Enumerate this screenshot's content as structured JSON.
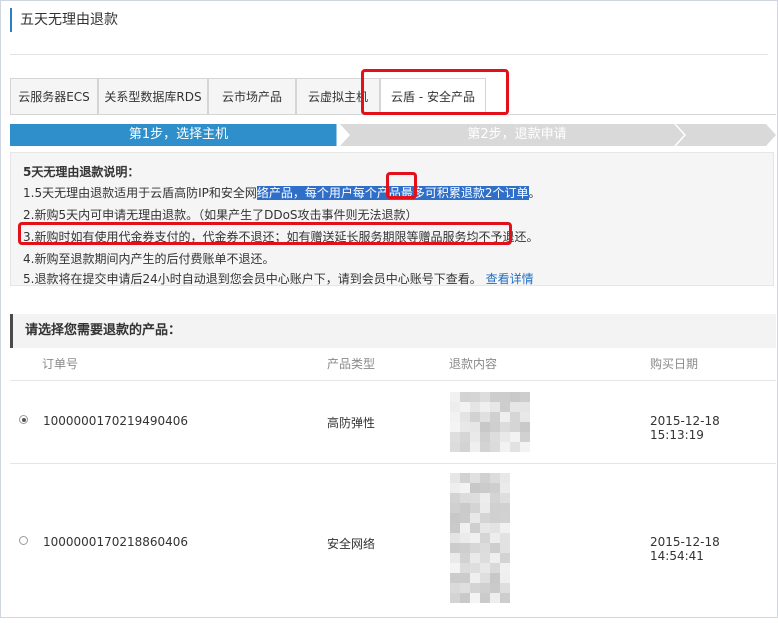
{
  "page": {
    "title": "五天无理由退款"
  },
  "tabs": [
    {
      "label": "云服务器ECS"
    },
    {
      "label": "关系型数据库RDS"
    },
    {
      "label": "云市场产品"
    },
    {
      "label": "云虚拟主机"
    },
    {
      "label": "云盾 - 安全产品",
      "active": true
    }
  ],
  "steps": [
    {
      "label": "第1步，选择主机",
      "active": true
    },
    {
      "label": "第2步，退款申请",
      "active": false
    }
  ],
  "notes": {
    "heading": "5天无理由退款说明：",
    "line1_plain": "1.5天无理由退款适用于云盾高防IP和安全网",
    "line1_highlight_a": "络产品，每个用户每个产品最多可",
    "line1_boxed": "积累",
    "line1_highlight_b": "退款2个订单",
    "line1_end": "。",
    "line2": "2.新购5天内可申请无理由退款。（如果产生了DDoS攻击事件则无法退款）",
    "line3": "3.新购时如有使用代金券支付的，代金券不退还；如有赠送延长服务期限等赠品服务均不予退还。",
    "line4": "4.新购至退款期间内产生的后付费账单不退还。",
    "line5": "5.退款将在提交申请后24小时自动退到您会员中心账户下，请到会员中心账号下查看。",
    "line5_link": "查看详情"
  },
  "section": {
    "title": "请选择您需要退款的产品："
  },
  "table": {
    "headers": [
      "订单号",
      "产品类型",
      "退款内容",
      "购买日期"
    ],
    "rows": [
      {
        "selected": true,
        "order": "1000000170219490406",
        "type": "高防弹性",
        "date": "2015-12-18 15:13:19"
      },
      {
        "selected": false,
        "order": "1000000170218860406",
        "type": "安全网络",
        "date": "2015-12-18 14:54:41"
      }
    ]
  },
  "colors": {
    "accent": "#2f8fca",
    "highlight_box": "#e3101a",
    "selection": "#2f6fc9"
  }
}
